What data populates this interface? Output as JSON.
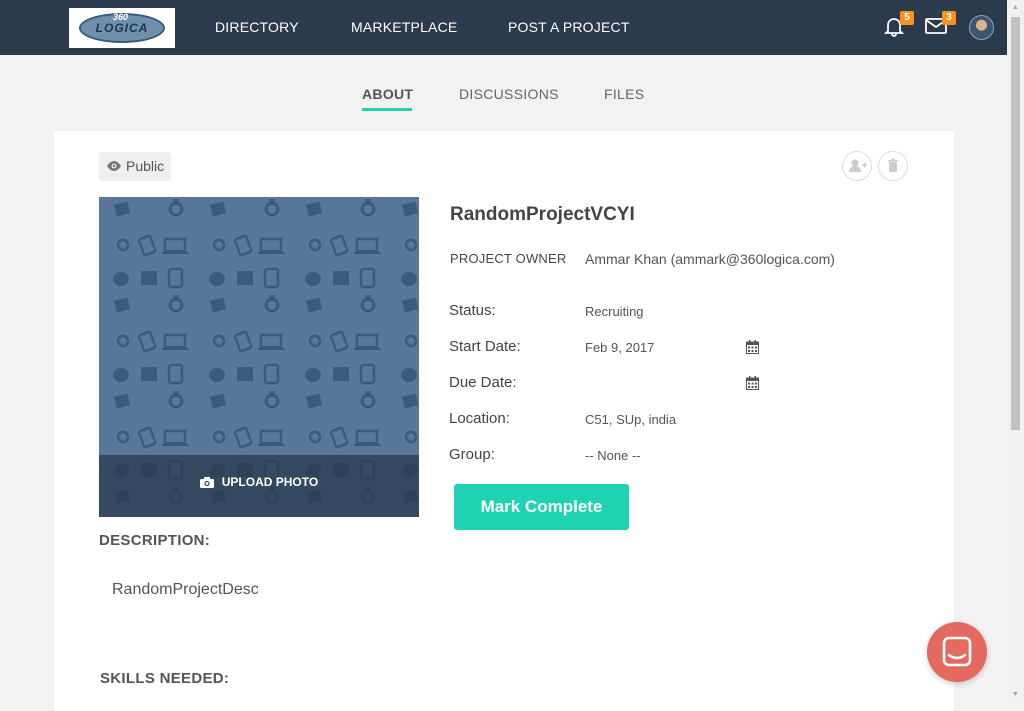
{
  "header": {
    "logo_text": "LOGICA",
    "logo_number": "360",
    "nav": [
      "DIRECTORY",
      "MARKETPLACE",
      "POST A PROJECT"
    ],
    "notifications_count": "5",
    "messages_count": "3"
  },
  "tabs": [
    {
      "label": "ABOUT",
      "active": true
    },
    {
      "label": "DISCUSSIONS",
      "active": false
    },
    {
      "label": "FILES",
      "active": false
    }
  ],
  "visibility": "Public",
  "photo": {
    "upload_label": "UPLOAD PHOTO"
  },
  "project": {
    "title": "RandomProjectVCYI",
    "owner_label": "PROJECT OWNER",
    "owner_value": "Ammar Khan (ammark@360logica.com)",
    "fields": {
      "status": {
        "label": "Status:",
        "value": "Recruiting"
      },
      "start_date": {
        "label": "Start Date:",
        "value": "Feb 9, 2017"
      },
      "due_date": {
        "label": "Due Date:",
        "value": ""
      },
      "location": {
        "label": "Location:",
        "value": "C51, SUp, india"
      },
      "group": {
        "label": "Group:",
        "value": "-- None --"
      }
    },
    "mark_complete_label": "Mark Complete"
  },
  "description": {
    "heading": "DESCRIPTION:",
    "text": "RandomProjectDesc"
  },
  "skills": {
    "heading": "SKILLS NEEDED:"
  },
  "colors": {
    "nav_bg": "#2b3a4c",
    "accent": "#1fd3b2",
    "badge": "#f7931e",
    "chat": "#e46a60",
    "photo_bg": "#58779b"
  },
  "icons": [
    "bell-icon",
    "envelope-icon",
    "eye-icon",
    "add-user-icon",
    "trash-icon",
    "camera-icon",
    "calendar-icon",
    "chat-icon"
  ]
}
